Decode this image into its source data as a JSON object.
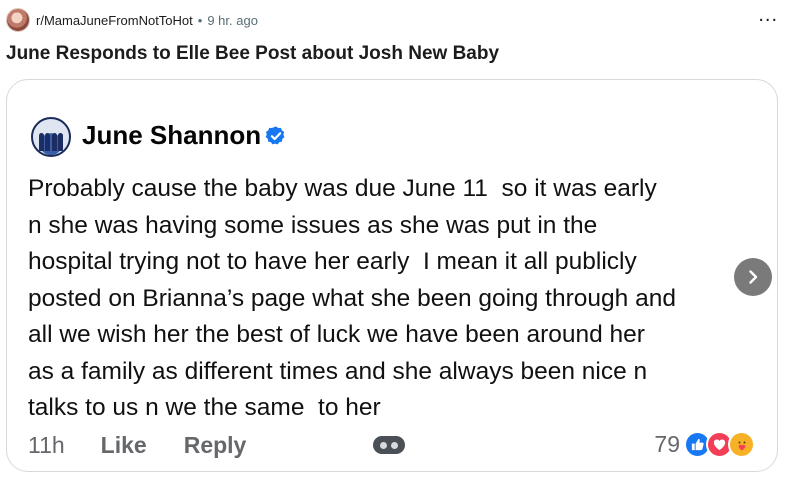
{
  "post": {
    "subreddit": "r/MamaJuneFromNotToHot",
    "separator": "•",
    "time_ago": "9 hr. ago",
    "more_label": "...",
    "title": "June Responds to Elle Bee Post about Josh New Baby"
  },
  "comment": {
    "author": "June Shannon",
    "verified": true,
    "body": "Probably cause the baby was due June 11  so it was early\nn she was having some issues as she was put in the\nhospital trying not to have her early  I mean it all publicly\nposted on Brianna’s page what she been going through and\nall we wish her the best of luck we have been around her\nas a family as different times and she always been nice n\ntalks to us n we the same  to her",
    "time": "11h",
    "like_label": "Like",
    "reply_label": "Reply",
    "reaction_count": "79",
    "reactions": [
      "like-icon",
      "love-icon",
      "care-icon"
    ]
  },
  "colors": {
    "facebook_blue": "#1877f2",
    "love_red": "#f33e58",
    "care_yellow": "#f7b125",
    "meta_gray": "#65676b"
  }
}
